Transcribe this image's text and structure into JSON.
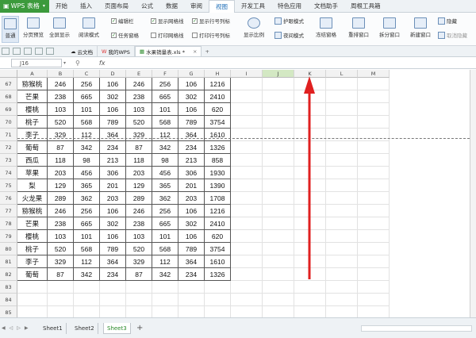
{
  "app": {
    "name": "WPS 表格"
  },
  "menu": [
    "开始",
    "插入",
    "页面布局",
    "公式",
    "数据",
    "审阅",
    "视图",
    "开发工具",
    "特色应用",
    "文档助手",
    "周根工具箱"
  ],
  "active_menu": "视图",
  "ribbon": {
    "buttons": [
      "普通",
      "分页预览",
      "全屏显示",
      "阅读模式",
      "显示比例",
      "冻结窗格",
      "重排窗口",
      "拆分窗口",
      "新建窗口"
    ],
    "checks": [
      "编辑栏",
      "任务窗格",
      "显示网格线",
      "打印网格线",
      "显示行号列标",
      "打印行号列标"
    ],
    "eye_protect": "护眼模式",
    "night_mode": "夜间模式",
    "hide": "隐藏",
    "unhide": "取消隐藏"
  },
  "tabs": [
    "云文档",
    "我的WPS",
    "水果销量表.xls *"
  ],
  "name_box": "J16",
  "fx": "fx",
  "columns": [
    "A",
    "B",
    "C",
    "D",
    "E",
    "F",
    "G",
    "H",
    "I",
    "J",
    "K",
    "L",
    "M"
  ],
  "rows": [
    {
      "n": "67",
      "cells": [
        "猕猴桃",
        "246",
        "256",
        "106",
        "246",
        "256",
        "106",
        "1216"
      ]
    },
    {
      "n": "68",
      "cells": [
        "芒果",
        "238",
        "665",
        "302",
        "238",
        "665",
        "302",
        "2410"
      ]
    },
    {
      "n": "69",
      "cells": [
        "樱桃",
        "103",
        "101",
        "106",
        "103",
        "101",
        "106",
        "620"
      ]
    },
    {
      "n": "70",
      "cells": [
        "桃子",
        "520",
        "568",
        "789",
        "520",
        "568",
        "789",
        "3754"
      ]
    },
    {
      "n": "71",
      "cells": [
        "李子",
        "329",
        "112",
        "364",
        "329",
        "112",
        "364",
        "1610"
      ]
    },
    {
      "n": "72",
      "cells": [
        "葡萄",
        "87",
        "342",
        "234",
        "87",
        "342",
        "234",
        "1326"
      ]
    },
    {
      "n": "73",
      "cells": [
        "西瓜",
        "118",
        "98",
        "213",
        "118",
        "98",
        "213",
        "858"
      ]
    },
    {
      "n": "74",
      "cells": [
        "苹果",
        "203",
        "456",
        "306",
        "203",
        "456",
        "306",
        "1930"
      ]
    },
    {
      "n": "75",
      "cells": [
        "梨",
        "129",
        "365",
        "201",
        "129",
        "365",
        "201",
        "1390"
      ]
    },
    {
      "n": "76",
      "cells": [
        "火龙果",
        "289",
        "362",
        "203",
        "289",
        "362",
        "203",
        "1708"
      ]
    },
    {
      "n": "77",
      "cells": [
        "猕猴桃",
        "246",
        "256",
        "106",
        "246",
        "256",
        "106",
        "1216"
      ]
    },
    {
      "n": "78",
      "cells": [
        "芒果",
        "238",
        "665",
        "302",
        "238",
        "665",
        "302",
        "2410"
      ]
    },
    {
      "n": "79",
      "cells": [
        "樱桃",
        "103",
        "101",
        "106",
        "103",
        "101",
        "106",
        "620"
      ]
    },
    {
      "n": "80",
      "cells": [
        "桃子",
        "520",
        "568",
        "789",
        "520",
        "568",
        "789",
        "3754"
      ]
    },
    {
      "n": "81",
      "cells": [
        "李子",
        "329",
        "112",
        "364",
        "329",
        "112",
        "364",
        "1610"
      ]
    },
    {
      "n": "82",
      "cells": [
        "葡萄",
        "87",
        "342",
        "234",
        "87",
        "342",
        "234",
        "1326"
      ]
    },
    {
      "n": "83",
      "cells": [
        "",
        "",
        "",
        "",
        "",
        "",
        "",
        ""
      ]
    },
    {
      "n": "84",
      "cells": [
        "",
        "",
        "",
        "",
        "",
        "",
        "",
        ""
      ]
    },
    {
      "n": "85",
      "cells": [
        "",
        "",
        "",
        "",
        "",
        "",
        "",
        ""
      ]
    }
  ],
  "sheets": [
    "Sheet1",
    "Sheet2",
    "Sheet3"
  ],
  "active_sheet": "Sheet3",
  "colors": {
    "app_green": "#3c9a3c",
    "accent_blue": "#1f6fb8",
    "arrow_red": "#e02020"
  }
}
